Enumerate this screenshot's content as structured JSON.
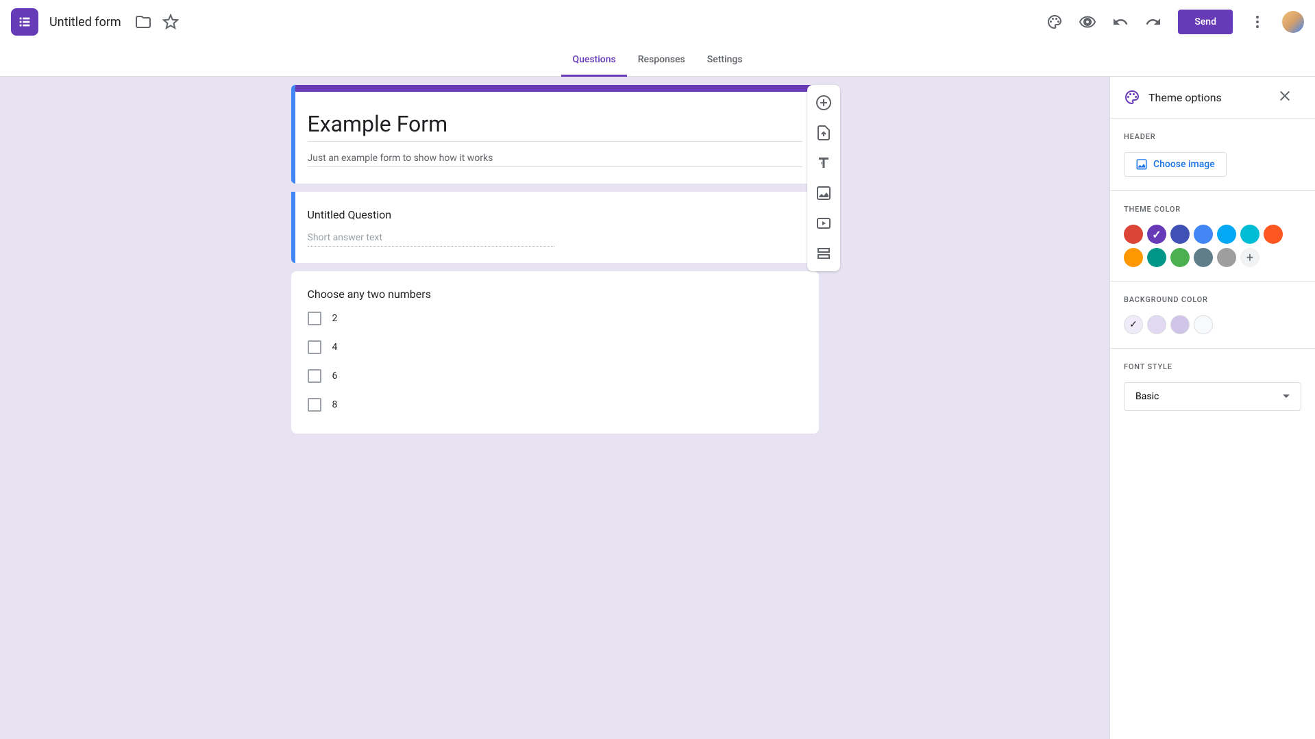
{
  "header": {
    "form_name": "Untitled form",
    "send_label": "Send"
  },
  "tabs": {
    "questions": "Questions",
    "responses": "Responses",
    "settings": "Settings"
  },
  "form": {
    "title": "Example Form",
    "description": "Just an example form to show how it works",
    "questions": [
      {
        "title": "Untitled Question",
        "type": "short_answer",
        "placeholder": "Short answer text"
      },
      {
        "title": "Choose any two numbers",
        "type": "checkbox",
        "options": [
          "2",
          "4",
          "6",
          "8"
        ]
      }
    ]
  },
  "theme_panel": {
    "title": "Theme options",
    "sections": {
      "header": "HEADER",
      "theme_color": "THEME COLOR",
      "background_color": "BACKGROUND COLOR",
      "font_style": "FONT STYLE"
    },
    "choose_image": "Choose image",
    "theme_colors": [
      "#db4437",
      "#673ab7",
      "#3f51b5",
      "#4285f4",
      "#03a9f4",
      "#00bcd4",
      "#ff5722",
      "#ff9800",
      "#009688",
      "#4caf50",
      "#607d8b",
      "#9e9e9e"
    ],
    "theme_color_selected_index": 1,
    "bg_colors": [
      "#f0ebf8",
      "#e1d8f1",
      "#d1c4e9",
      "#f8f9fa"
    ],
    "bg_selected_index": 0,
    "font_value": "Basic"
  }
}
